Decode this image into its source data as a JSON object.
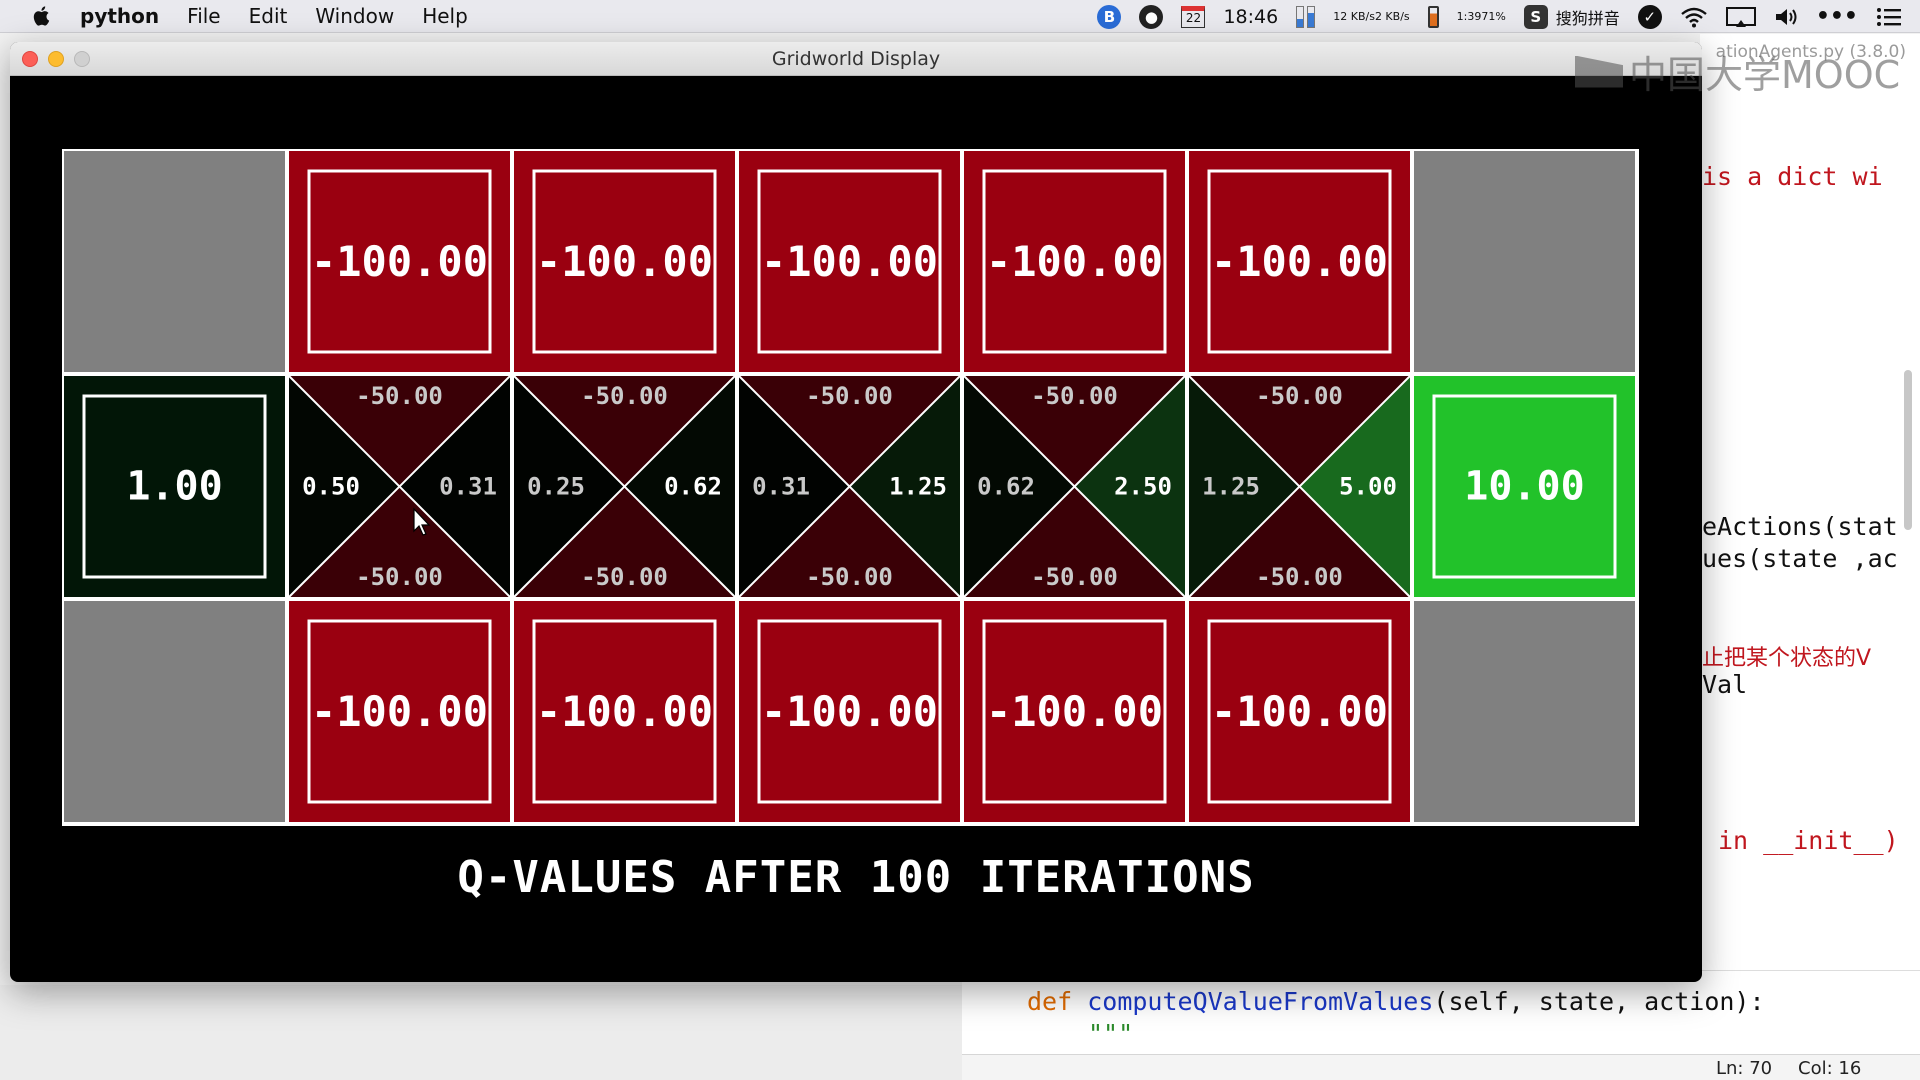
{
  "menubar": {
    "app": "python",
    "items": [
      "File",
      "Edit",
      "Window",
      "Help"
    ],
    "status": {
      "date_badge": "22",
      "time": "18:46",
      "net_up": "12 KB/s",
      "net_down": "2 KB/s",
      "battery_time": "1:39",
      "battery_pct": "71%",
      "ime": "搜狗拼音"
    }
  },
  "window": {
    "title": "Gridworld Display",
    "caption": "Q-VALUES AFTER 100 ITERATIONS"
  },
  "grid": {
    "cols": 7,
    "rows": 3,
    "cells": [
      {
        "r": 0,
        "c": 0,
        "kind": "wall"
      },
      {
        "r": 0,
        "c": 1,
        "kind": "terminal",
        "value": "-100.00",
        "color": "#9a0010"
      },
      {
        "r": 0,
        "c": 2,
        "kind": "terminal",
        "value": "-100.00",
        "color": "#9a0010"
      },
      {
        "r": 0,
        "c": 3,
        "kind": "terminal",
        "value": "-100.00",
        "color": "#9a0010"
      },
      {
        "r": 0,
        "c": 4,
        "kind": "terminal",
        "value": "-100.00",
        "color": "#9a0010"
      },
      {
        "r": 0,
        "c": 5,
        "kind": "terminal",
        "value": "-100.00",
        "color": "#9a0010"
      },
      {
        "r": 0,
        "c": 6,
        "kind": "wall"
      },
      {
        "r": 1,
        "c": 0,
        "kind": "terminal",
        "value": "1.00",
        "color": "#021607"
      },
      {
        "r": 1,
        "c": 1,
        "kind": "q",
        "north": "-50.00",
        "south": "-50.00",
        "west": "0.50",
        "east": "0.31",
        "colors": {
          "north": "#3a0006",
          "south": "#3a0006",
          "west": "#020602",
          "east": "#010301"
        }
      },
      {
        "r": 1,
        "c": 2,
        "kind": "q",
        "north": "-50.00",
        "south": "-50.00",
        "west": "0.25",
        "east": "0.62",
        "colors": {
          "north": "#3a0006",
          "south": "#3a0006",
          "west": "#010301",
          "east": "#030903"
        }
      },
      {
        "r": 1,
        "c": 3,
        "kind": "q",
        "north": "-50.00",
        "south": "-50.00",
        "west": "0.31",
        "east": "1.25",
        "colors": {
          "north": "#3a0006",
          "south": "#3a0006",
          "west": "#010301",
          "east": "#061a08"
        }
      },
      {
        "r": 1,
        "c": 4,
        "kind": "q",
        "north": "-50.00",
        "south": "-50.00",
        "west": "0.62",
        "east": "2.50",
        "colors": {
          "north": "#3a0006",
          "south": "#3a0006",
          "west": "#030903",
          "east": "#0c3310"
        }
      },
      {
        "r": 1,
        "c": 5,
        "kind": "q",
        "north": "-50.00",
        "south": "-50.00",
        "west": "1.25",
        "east": "5.00",
        "colors": {
          "north": "#3a0006",
          "south": "#3a0006",
          "west": "#061a08",
          "east": "#186a1e"
        }
      },
      {
        "r": 1,
        "c": 6,
        "kind": "terminal",
        "value": "10.00",
        "color": "#22c22a"
      },
      {
        "r": 2,
        "c": 0,
        "kind": "wall"
      },
      {
        "r": 2,
        "c": 1,
        "kind": "terminal",
        "value": "-100.00",
        "color": "#9a0010"
      },
      {
        "r": 2,
        "c": 2,
        "kind": "terminal",
        "value": "-100.00",
        "color": "#9a0010"
      },
      {
        "r": 2,
        "c": 3,
        "kind": "terminal",
        "value": "-100.00",
        "color": "#9a0010"
      },
      {
        "r": 2,
        "c": 4,
        "kind": "terminal",
        "value": "-100.00",
        "color": "#9a0010"
      },
      {
        "r": 2,
        "c": 5,
        "kind": "terminal",
        "value": "-100.00",
        "color": "#9a0010"
      },
      {
        "r": 2,
        "c": 6,
        "kind": "wall"
      }
    ],
    "wall_color": "#808080"
  },
  "editor": {
    "lines": [
      "is a dict wi",
      "eActions(stat",
      "ues(state ,ac",
      "止把某个状态的V",
      "Val",
      "in __init__)"
    ],
    "def_keyword": "def",
    "def_name": "computeQValueFromValues",
    "def_args": "(self, state, action):",
    "docstring": "\"\"\"",
    "file_label": "ationAgents.py (3.8.0)",
    "status_line": "Ln: 70",
    "status_col": "Col: 16"
  },
  "watermark": {
    "text": "中国大学MOOC"
  }
}
